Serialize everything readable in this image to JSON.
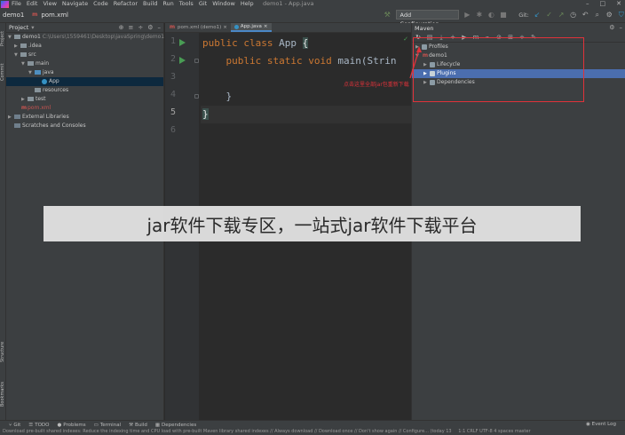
{
  "window": {
    "title": "demo1 - App.java",
    "menu": [
      "File",
      "Edit",
      "View",
      "Navigate",
      "Code",
      "Refactor",
      "Build",
      "Run",
      "Tools",
      "Git",
      "Window",
      "Help"
    ]
  },
  "navbar": {
    "project": "demo1",
    "file": "pom.xml",
    "add_configuration": "Add Configuration...",
    "git_label": "Git:"
  },
  "project_panel": {
    "title": "Project",
    "tree": [
      {
        "label": "demo1",
        "detail": "C:\\Users\\1559461\\Desktop\\javaSpring\\demo1",
        "depth": 0
      },
      {
        "label": ".idea",
        "depth": 1
      },
      {
        "label": "src",
        "depth": 1
      },
      {
        "label": "main",
        "depth": 2
      },
      {
        "label": "java",
        "depth": 3
      },
      {
        "label": "App",
        "depth": 4
      },
      {
        "label": "resources",
        "depth": 3
      },
      {
        "label": "test",
        "depth": 2
      },
      {
        "label": "pom.xml",
        "depth": 1
      },
      {
        "label": "External Libraries",
        "depth": 0
      },
      {
        "label": "Scratches and Consoles",
        "depth": 0
      }
    ]
  },
  "editor": {
    "tabs": [
      "pom.xml (demo1)",
      "App.java"
    ],
    "line_numbers": [
      "1",
      "2",
      "3",
      "4",
      "5",
      "6"
    ],
    "code": {
      "l1_kw": "public class ",
      "l1_name": "App ",
      "l1_brace": "{",
      "l2_kw": "    public static void ",
      "l2_rest": "main(Strin",
      "l4": "    }",
      "l5": "}"
    }
  },
  "maven_panel": {
    "title": "Maven",
    "tree": [
      {
        "label": "Profiles"
      },
      {
        "label": "demo1"
      },
      {
        "label": "Lifecycle"
      },
      {
        "label": "Plugins"
      },
      {
        "label": "Dependencies"
      }
    ],
    "annotation": "点击这里全部jar包重新下载"
  },
  "banner": {
    "text": "jar软件下载专区，一站式jar软件下载平台"
  },
  "left_stripe": {
    "top": [
      "Project",
      "Commit"
    ],
    "bottom": [
      "Structure",
      "Bookmarks"
    ]
  },
  "bottom_tools": [
    "Git",
    "TODO",
    "Problems",
    "Terminal",
    "Build",
    "Dependencies"
  ],
  "event_log": "Event Log",
  "status_bar": {
    "message": "Download pre-built shared indexes: Reduce the indexing time and CPU load with pre-built Maven library shared indexes // Always download // Download once // Don't show again // Configure... (today 13",
    "right": "1:1  CRLF  UTF-8  4 spaces  master"
  },
  "colors": {
    "annotation_red": "#e0323a",
    "selection": "#4b6eaf",
    "keyword": "#cc7832",
    "run_green": "#499c54"
  }
}
